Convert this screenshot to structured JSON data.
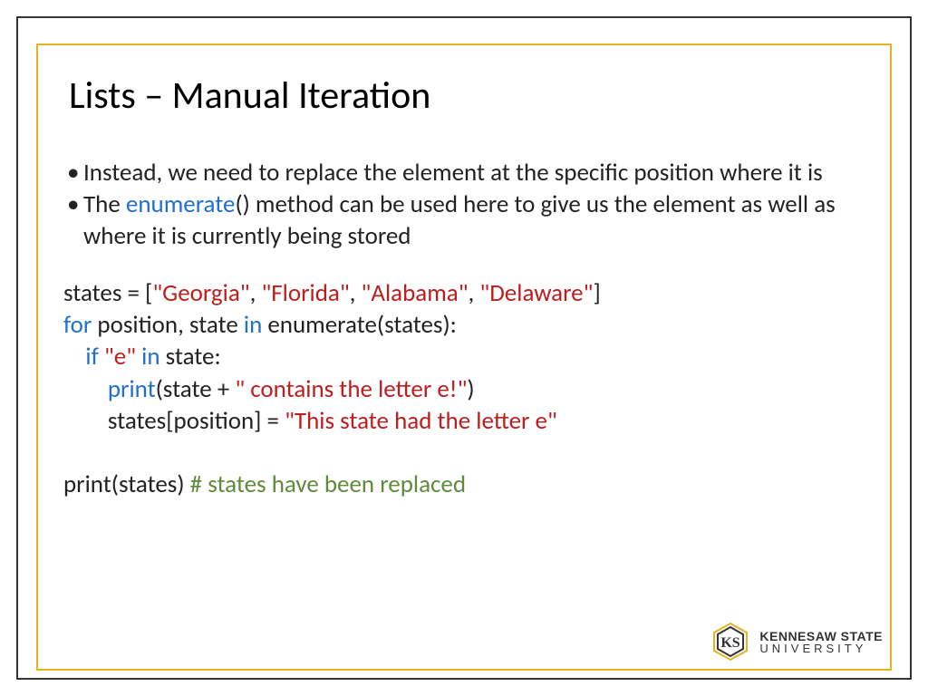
{
  "title": "Lists – Manual Iteration",
  "bullets": {
    "b1": "Instead, we need to replace the element at the specific position where it is",
    "b2_pre": "The ",
    "b2_kw": "enumerate",
    "b2_post": "() method can be used here to give us the element as well as where it is currently being stored"
  },
  "code": {
    "l1_pre": "states = [",
    "l1_s1": "\"Georgia\"",
    "l1_c1": ", ",
    "l1_s2": "\"Florida\"",
    "l1_c2": ", ",
    "l1_s3": "\"Alabama\"",
    "l1_c3": ", ",
    "l1_s4": "\"Delaware\"",
    "l1_end": "]",
    "l2_for": "for",
    "l2_mid": " position, state ",
    "l2_in": "in",
    "l2_end": " enumerate(states):",
    "l3_pad": "    ",
    "l3_if": "if ",
    "l3_e": "\"e\" ",
    "l3_in": "in",
    "l3_end": " state:",
    "l4_pad": "        ",
    "l4_print": "print",
    "l4_mid": "(state + ",
    "l4_str": "\" contains the letter e!\"",
    "l4_end": ")",
    "l5_pad": "        ",
    "l5_lhs": "states[position] = ",
    "l5_str": "\"This state had the letter e\"",
    "l7_pre": "print(states) ",
    "l7_comment": "# states have been replaced"
  },
  "logo": {
    "line1": "KENNESAW STATE",
    "line2": "UNIVERSITY"
  }
}
